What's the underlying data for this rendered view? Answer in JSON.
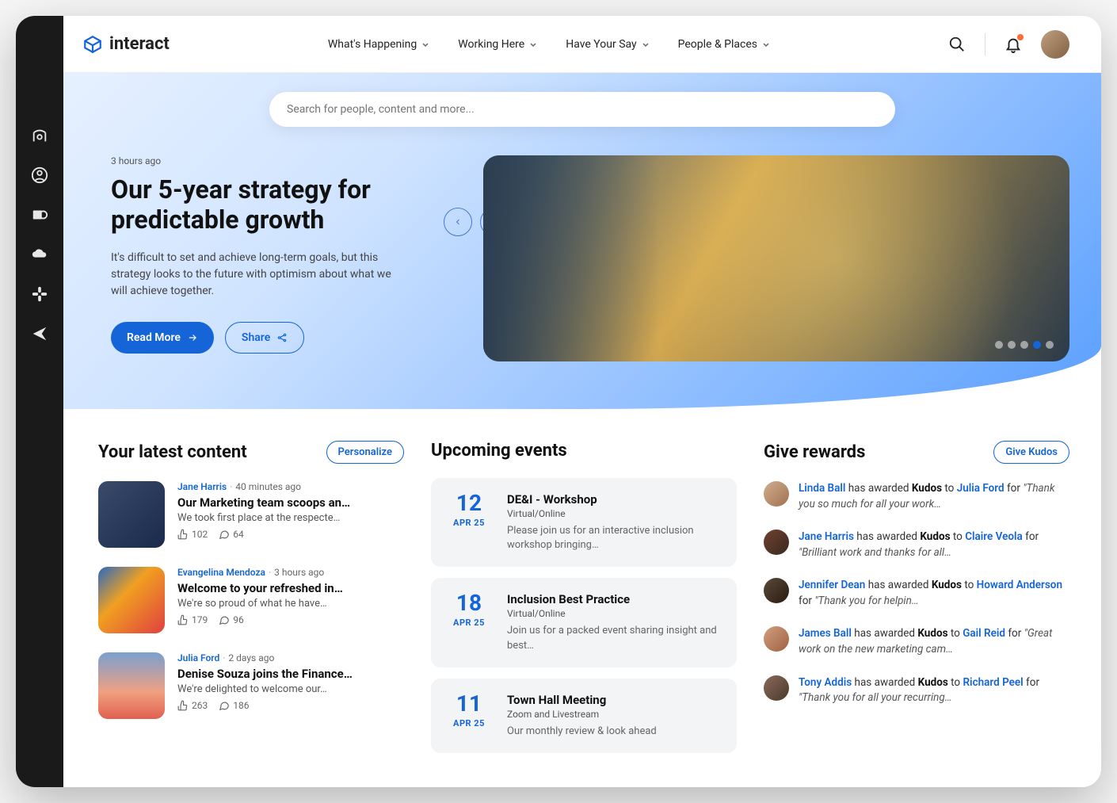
{
  "brand": "interact",
  "nav": {
    "items": [
      {
        "label": "What's Happening"
      },
      {
        "label": "Working Here"
      },
      {
        "label": "Have Your Say"
      },
      {
        "label": "People & Places"
      }
    ]
  },
  "search": {
    "placeholder": "Search for people, content and more..."
  },
  "hero": {
    "time": "3 hours ago",
    "title": "Our 5-year strategy for predictable growth",
    "desc": "It's difficult to set and achieve long-term goals, but this strategy looks to the future with optimism about what we will achieve together.",
    "read_more": "Read More",
    "share": "Share",
    "dot_count": 5,
    "dot_active": 3
  },
  "latest": {
    "title": "Your latest content",
    "personalize": "Personalize",
    "items": [
      {
        "author": "Jane Harris",
        "time": "40 minutes ago",
        "title": "Our Marketing team scoops an…",
        "excerpt": "We took first place at the respecte…",
        "likes": "102",
        "comments": "64"
      },
      {
        "author": "Evangelina Mendoza",
        "time": "3 hours ago",
        "title": "Welcome to your refreshed in…",
        "excerpt": "We're so proud of what he have…",
        "likes": "179",
        "comments": "96"
      },
      {
        "author": "Julia Ford",
        "time": "2 days ago",
        "title": "Denise Souza joins the Finance…",
        "excerpt": "We're delighted to welcome our…",
        "likes": "263",
        "comments": "186"
      }
    ]
  },
  "events": {
    "title": "Upcoming events",
    "items": [
      {
        "day": "12",
        "month": "APR 25",
        "title": "DE&I - Workshop",
        "loc": "Virtual/Online",
        "desc": "Please join us for an interactive inclusion workshop bringing…"
      },
      {
        "day": "18",
        "month": "APR 25",
        "title": "Inclusion Best Practice",
        "loc": "Virtual/Online",
        "desc": "Join us for a packed event sharing insight and best…"
      },
      {
        "day": "11",
        "month": "APR 25",
        "title": "Town Hall Meeting",
        "loc": "Zoom and Livestream",
        "desc": "Our monthly review & look ahead"
      }
    ]
  },
  "rewards": {
    "title": "Give rewards",
    "give_kudos": "Give Kudos",
    "items": [
      {
        "giver": "Linda Ball",
        "mid": " has awarded ",
        "award": "Kudos",
        "to": " to ",
        "receiver": "Julia Ford",
        "for": " for ",
        "quote": "\"Thank you so much for all your work…"
      },
      {
        "giver": "Jane Harris",
        "mid": " has awarded ",
        "award": "Kudos",
        "to": " to ",
        "receiver": "Claire Veola",
        "for": " for ",
        "quote": "\"Brilliant work and thanks for all…"
      },
      {
        "giver": "Jennifer Dean",
        "mid": " has awarded ",
        "award": "Kudos",
        "to": " to ",
        "receiver": "Howard Anderson",
        "for": " for ",
        "quote": "\"Thank you for helpin…"
      },
      {
        "giver": "James Ball",
        "mid": " has awarded ",
        "award": "Kudos",
        "to": " to ",
        "receiver": "Gail Reid",
        "for": " for ",
        "quote": "\"Great work on the new marketing cam…"
      },
      {
        "giver": "Tony Addis",
        "mid": " has awarded ",
        "award": "Kudos",
        "to": " to ",
        "receiver": "Richard Peel",
        "for": " for ",
        "quote": "\"Thank you for all your recurring…"
      }
    ]
  }
}
